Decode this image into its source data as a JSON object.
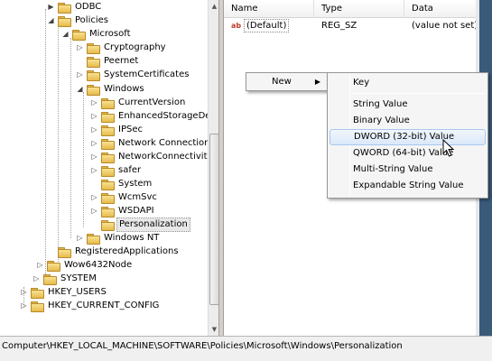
{
  "tree": {
    "items": [
      {
        "label": "ODBC",
        "expander": "▶"
      },
      {
        "label": "Policies",
        "expander": "◢"
      },
      {
        "label": "Microsoft",
        "expander": "◢"
      },
      {
        "label": "Cryptography",
        "expander": "▷"
      },
      {
        "label": "Peernet",
        "expander": ""
      },
      {
        "label": "SystemCertificates",
        "expander": "▷"
      },
      {
        "label": "Windows",
        "expander": "◢"
      },
      {
        "label": "CurrentVersion",
        "expander": "▷"
      },
      {
        "label": "EnhancedStorageDevic",
        "expander": "▷"
      },
      {
        "label": "IPSec",
        "expander": "▷"
      },
      {
        "label": "Network Connections",
        "expander": "▷"
      },
      {
        "label": "NetworkConnectivitySt",
        "expander": "▷"
      },
      {
        "label": "safer",
        "expander": "▷"
      },
      {
        "label": "System",
        "expander": ""
      },
      {
        "label": "WcmSvc",
        "expander": "▷"
      },
      {
        "label": "WSDAPI",
        "expander": "▷"
      },
      {
        "label": "Personalization",
        "expander": ""
      },
      {
        "label": "Windows NT",
        "expander": "▷"
      },
      {
        "label": "RegisteredApplications",
        "expander": ""
      },
      {
        "label": "Wow6432Node",
        "expander": "▷"
      },
      {
        "label": "SYSTEM",
        "expander": "▷"
      },
      {
        "label": "HKEY_USERS",
        "expander": "▷"
      },
      {
        "label": "HKEY_CURRENT_CONFIG",
        "expander": "▷"
      }
    ]
  },
  "list": {
    "headers": {
      "name": "Name",
      "type": "Type",
      "data": "Data"
    },
    "rows": [
      {
        "name": "(Default)",
        "type": "REG_SZ",
        "data": "(value not set)",
        "icon": "ab"
      }
    ]
  },
  "context_menu": {
    "new_label": "New",
    "arrow": "▶"
  },
  "submenu": {
    "items": [
      "Key",
      "String Value",
      "Binary Value",
      "DWORD (32-bit) Value",
      "QWORD (64-bit) Value",
      "Multi-String Value",
      "Expandable String Value"
    ]
  },
  "status_bar": {
    "path": "Computer\\HKEY_LOCAL_MACHINE\\SOFTWARE\\Policies\\Microsoft\\Windows\\Personalization"
  },
  "colors": {
    "highlight": "#dbe8f9",
    "folder": "#e6bb4c"
  }
}
